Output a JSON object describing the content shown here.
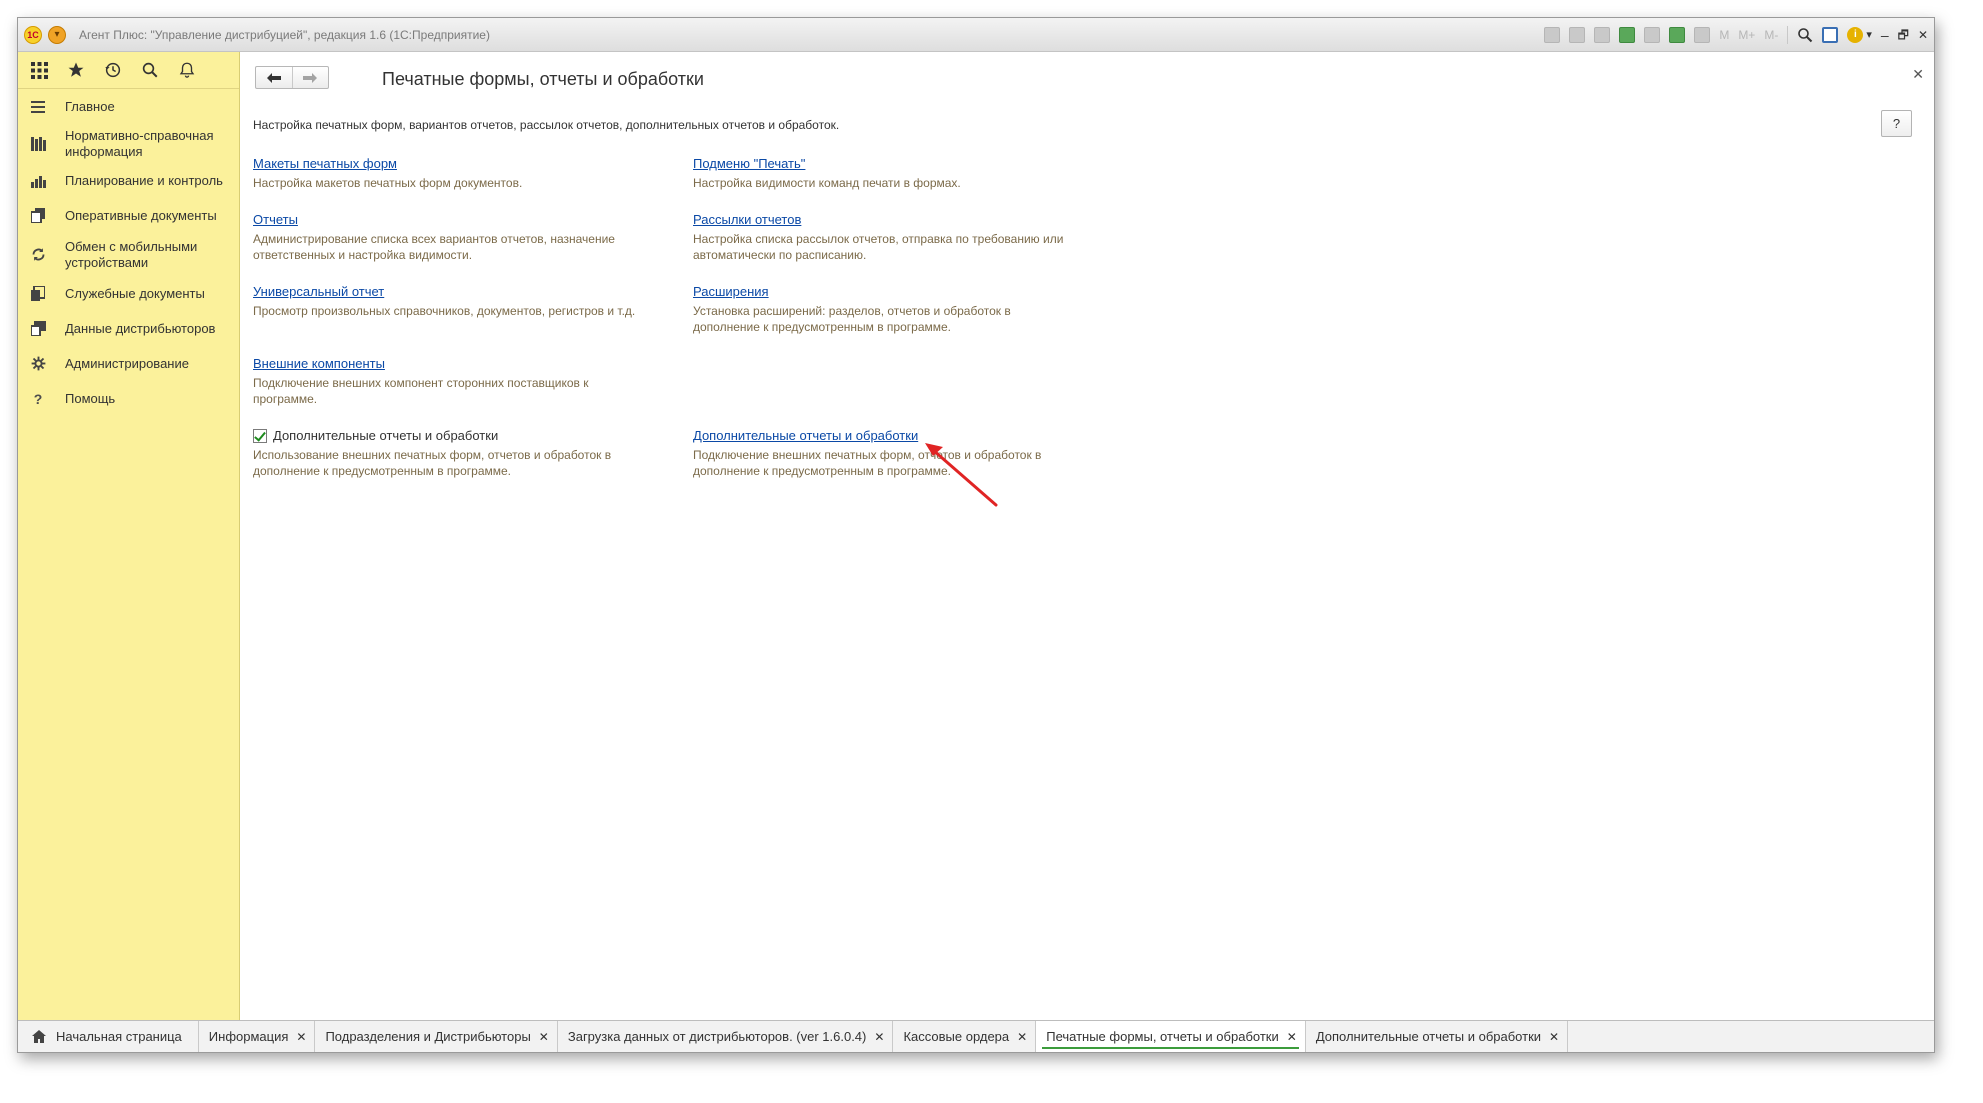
{
  "window": {
    "title": "Агент Плюс: \"Управление дистрибуцией\", редакция 1.6  (1С:Предприятие)",
    "logo_text": "1С",
    "menu_glyph": "▾",
    "toolbar_text_m": "M",
    "toolbar_text_mplus": "M+",
    "toolbar_text_mminus": "M-",
    "info_glyph": "i",
    "dropdown_glyph": "▾",
    "minimize_glyph": "–",
    "restore_glyph": "🗗",
    "close_glyph": "✕"
  },
  "sidebar": {
    "items": [
      {
        "label": "Главное",
        "icon": "menu-lines-icon"
      },
      {
        "label": "Нормативно-справочная информация",
        "icon": "books-icon"
      },
      {
        "label": "Планирование и контроль",
        "icon": "bar-chart-icon"
      },
      {
        "label": "Оперативные документы",
        "icon": "documents-icon"
      },
      {
        "label": "Обмен с мобильными устройствами",
        "icon": "sync-icon"
      },
      {
        "label": "Служебные документы",
        "icon": "service-docs-icon"
      },
      {
        "label": "Данные дистрибьюторов",
        "icon": "distributor-data-icon"
      },
      {
        "label": "Администрирование",
        "icon": "gear-icon"
      },
      {
        "label": "Помощь",
        "icon": "question-icon"
      }
    ]
  },
  "content": {
    "title": "Печатные формы, отчеты и обработки",
    "intro": "Настройка печатных форм, вариантов отчетов, рассылок отчетов, дополнительных отчетов и обработок.",
    "help_label": "?",
    "close_glyph": "✕",
    "blocks": {
      "print_layouts": {
        "link": "Макеты печатных форм",
        "desc": "Настройка макетов печатных форм документов."
      },
      "print_submenu": {
        "link": "Подменю \"Печать\"",
        "desc": "Настройка видимости команд печати в формах."
      },
      "reports": {
        "link": "Отчеты",
        "desc": "Администрирование списка всех вариантов отчетов, назначение ответственных и настройка видимости."
      },
      "report_mailings": {
        "link": "Рассылки отчетов",
        "desc": "Настройка списка рассылок отчетов, отправка по требованию или автоматически по расписанию."
      },
      "universal_report": {
        "link": "Универсальный отчет",
        "desc": "Просмотр произвольных справочников, документов, регистров и т.д."
      },
      "extensions": {
        "link": "Расширения",
        "desc": "Установка расширений: разделов, отчетов и обработок в дополнение к предусмотренным в программе."
      },
      "external_components": {
        "link": "Внешние компоненты",
        "desc": "Подключение внешних компонент сторонних поставщиков к программе."
      },
      "additional_checkbox": {
        "label": "Дополнительные отчеты и обработки",
        "desc": "Использование внешних печатных форм, отчетов и обработок в дополнение к предусмотренным в программе.",
        "checked": true
      },
      "additional_link": {
        "link": "Дополнительные отчеты и обработки",
        "desc": "Подключение внешних печатных форм, отчетов и обработок в дополнение к предусмотренным в программе."
      }
    }
  },
  "tabs": [
    {
      "label": "Начальная страница",
      "closable": false,
      "active": false
    },
    {
      "label": "Информация",
      "closable": true,
      "active": false
    },
    {
      "label": "Подразделения и Дистрибьюторы",
      "closable": true,
      "active": false
    },
    {
      "label": "Загрузка данных от дистрибьюторов. (ver 1.6.0.4)",
      "closable": true,
      "active": false
    },
    {
      "label": "Кассовые ордера",
      "closable": true,
      "active": false
    },
    {
      "label": "Печатные формы, отчеты и обработки",
      "closable": true,
      "active": true
    },
    {
      "label": "Дополнительные отчеты и обработки",
      "closable": true,
      "active": false
    }
  ],
  "tab_close_glyph": "✕",
  "colors": {
    "sidebar_bg": "#fbf19b",
    "link": "#0b49a6",
    "annotation_arrow": "#e02424",
    "active_tab_marker": "#3c9c3c"
  }
}
